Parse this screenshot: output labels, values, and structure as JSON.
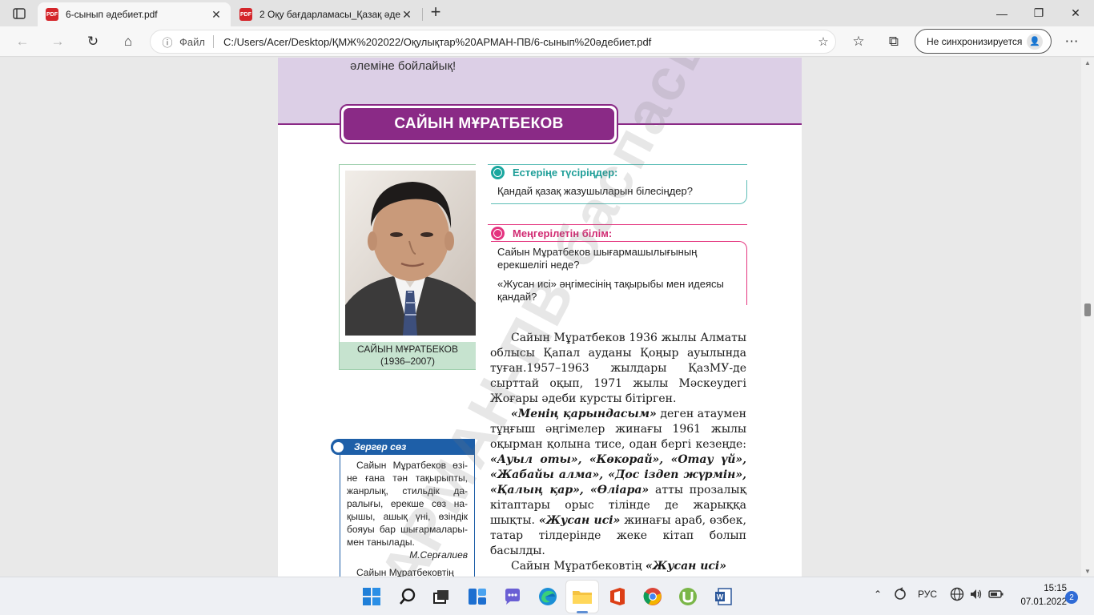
{
  "tabs": [
    {
      "title": "6-сынып әдебиет.pdf",
      "icon": "pdf-icon"
    },
    {
      "title": "2 Оқу бағдарламасы_Қазақ әде",
      "icon": "pdf-icon"
    }
  ],
  "address": {
    "scheme_label": "Файл",
    "url": "C:/Users/Acer/Desktop/ҚМЖ%202022/Оқулықтар%20АРМАН-ПВ/6-сынып%20әдебиет.pdf"
  },
  "sync": {
    "label": "Не синхронизируется"
  },
  "page": {
    "banner_text": "әлеміне бойлайық!",
    "title": "САЙЫН МҰРАТБЕКОВ",
    "portrait_caption_name": "САЙЫН МҰРАТБЕКОВ",
    "portrait_caption_years": "(1936–2007)",
    "recall": {
      "heading": "Естеріңе түсіріңдер:",
      "question": "Қандай қазақ жазушыларын білесіңдер?"
    },
    "learn": {
      "heading": "Меңгерілетін білім:",
      "q1": "Сайын Мұратбеков шығармашылығының ерекшелігі неде?",
      "q2": "«Жусан исі» әңгімесінің тақырыбы мен идеясы қандай?"
    },
    "para1": "Сайын Мұратбеков 1936 жылы Алматы облысы Қапал ауданы Қоңыр ауылында туған.1957–1963 жылдары ҚазМУ-де сырттай оқып, 1971 жылы Мәскеудегі Жоғары әдеби курсты бітірген.",
    "para2_lead": "«Менің қарындасым»",
    "para2_a": " деген атаумен тұңғыш әңгімелер жинағы 1961 жылы оқырман қолына тисе, одан бергі кезеңде: ",
    "para2_books": "«Ауыл оты», «Көкорай», «Отау үй», «Жабайы алма», «Дос іздеп жүрмін», «Қалың қар», «Өліара»",
    "para2_b": " атты прозалық кітаптары орыс тілінде де жарыққа шықты. ",
    "para2_lead2": "«Жусан исі»",
    "para2_c": " жинағы араб, өзбек, татар тілдерінде жеке кітап болып басылды.",
    "para3_a": "Сайын Мұратбековтің ",
    "para3_b": "«Жусан исі»",
    "side": {
      "heading": "Зергер сөз",
      "text": "Сайын Мұратбеков өзі-не ғана тән тақырыпты, жанрлық, стильдік да-ралығы, ерекше сөз на-қышы, ашық үні, өзіндік бояуы бар шығармалары-мен танылады.",
      "author": "М.Серғалиев",
      "text2": "Сайын Мұратбековтің"
    },
    "watermark": "АРМАН-ПВ баспасы"
  },
  "tray": {
    "lang": "РУС",
    "time": "15:15",
    "date": "07.01.2022",
    "notifications": "2"
  },
  "colors": {
    "accent_purple": "#8a2a86",
    "teal": "#1aa79f",
    "pink": "#e4337f",
    "blue": "#1e5fa8"
  }
}
